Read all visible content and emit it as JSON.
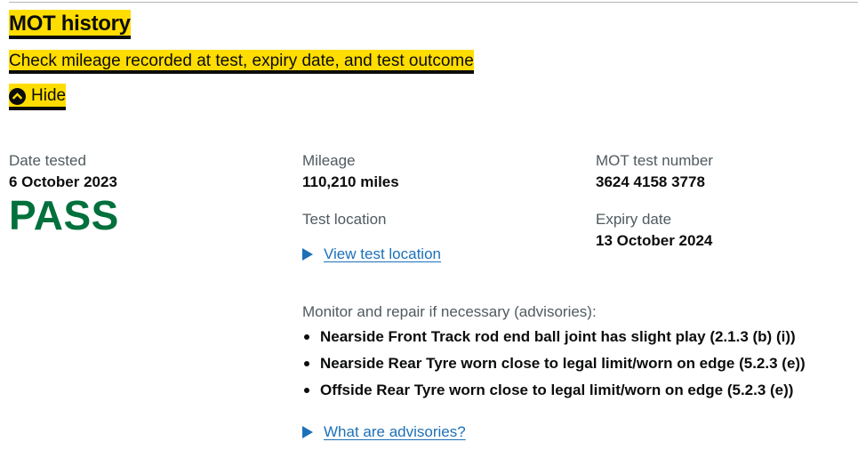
{
  "section": {
    "title": "MOT history",
    "summary": "Check mileage recorded at test, expiry date, and test outcome",
    "toggle_label": "Hide"
  },
  "test": {
    "date_label": "Date tested",
    "date_value": "6 October 2023",
    "result": "PASS",
    "mileage_label": "Mileage",
    "mileage_value": "110,210 miles",
    "location_label": "Test location",
    "location_link": "View test location",
    "test_number_label": "MOT test number",
    "test_number_value": "3624 4158 3778",
    "expiry_label": "Expiry date",
    "expiry_value": "13 October 2024"
  },
  "advisories": {
    "heading": "Monitor and repair if necessary (advisories):",
    "items": [
      "Nearside Front Track rod end ball joint has slight play (2.1.3 (b) (i))",
      "Nearside Rear Tyre worn close to legal limit/worn on edge (5.2.3 (e))",
      "Offside Rear Tyre worn close to legal limit/worn on edge (5.2.3 (e))"
    ],
    "help_link": "What are advisories?"
  },
  "colors": {
    "highlight": "#ffdd00",
    "pass": "#00703c",
    "link": "#1d70b8",
    "label_text": "#505a5f"
  },
  "icons": {
    "toggle": "chevron-up-circle-icon",
    "details": "triangle-right-icon"
  }
}
